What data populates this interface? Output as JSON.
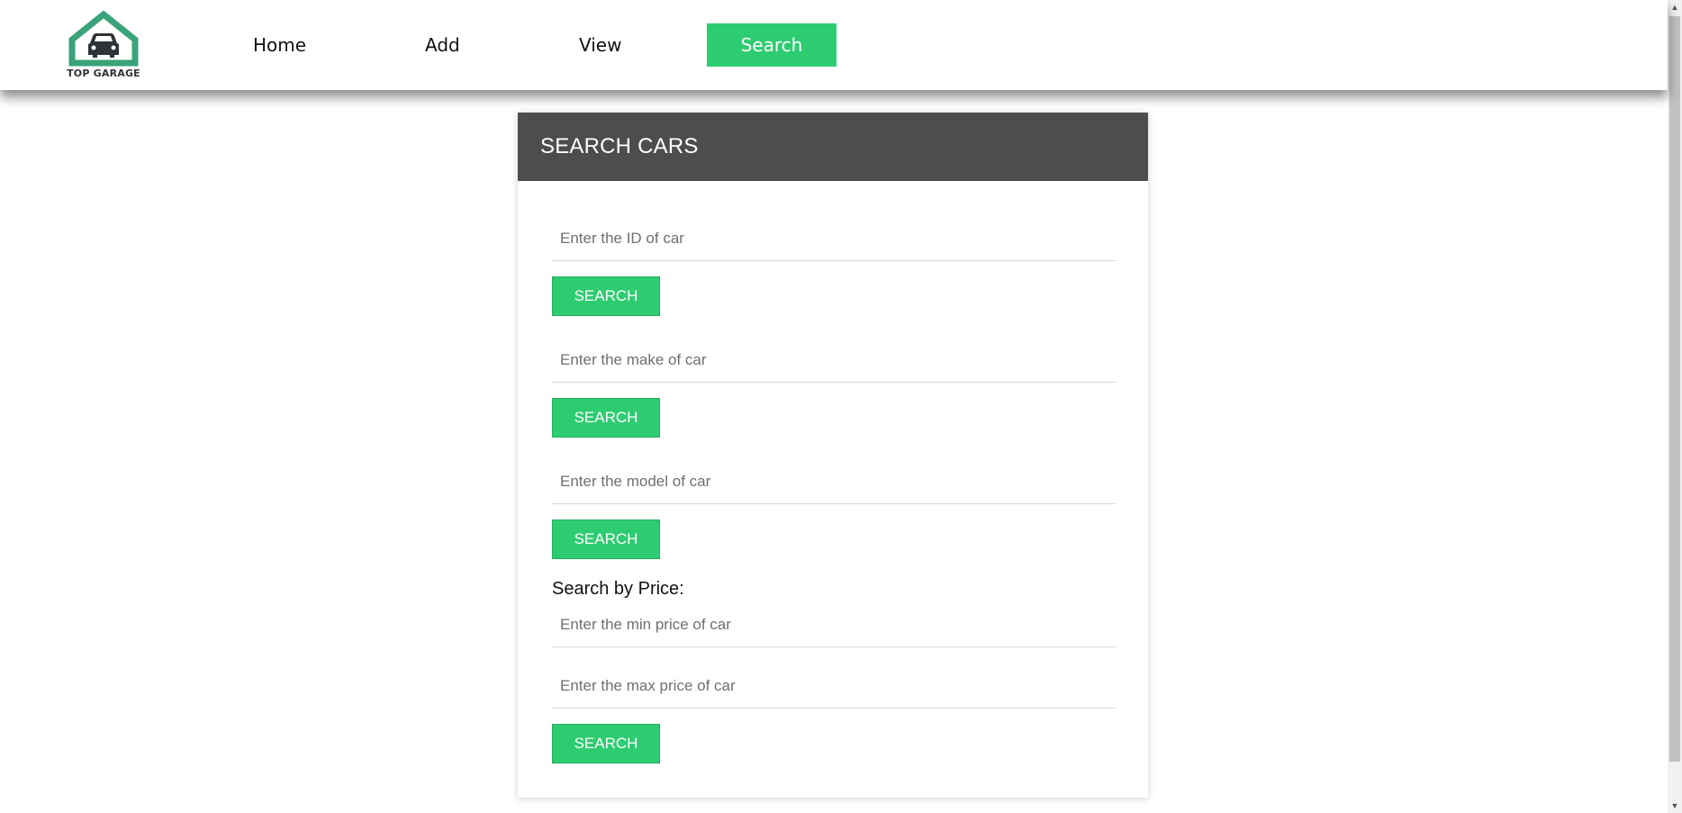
{
  "brand": {
    "logo_text": "TOP GARAGE",
    "colors": {
      "house": "#3aa37a",
      "car": "#2f3337"
    }
  },
  "nav": {
    "home": "Home",
    "add": "Add",
    "view": "View",
    "search": "Search"
  },
  "panel": {
    "title": "SEARCH CARS",
    "id_field": {
      "placeholder": "Enter the ID of car",
      "value": ""
    },
    "make_field": {
      "placeholder": "Enter the make of car",
      "value": ""
    },
    "model_field": {
      "placeholder": "Enter the model of car",
      "value": ""
    },
    "price_label": "Search by Price:",
    "min_price_field": {
      "placeholder": "Enter the min price of car",
      "value": ""
    },
    "max_price_field": {
      "placeholder": "Enter the max price of car",
      "value": ""
    },
    "search_button": "SEARCH"
  },
  "theme": {
    "accent": "#2ecc71",
    "header_bg": "#4d4d4d"
  },
  "icons": {
    "logo": "house-car-icon",
    "scroll_up": "chevron-up-icon",
    "scroll_down": "chevron-down-icon"
  }
}
